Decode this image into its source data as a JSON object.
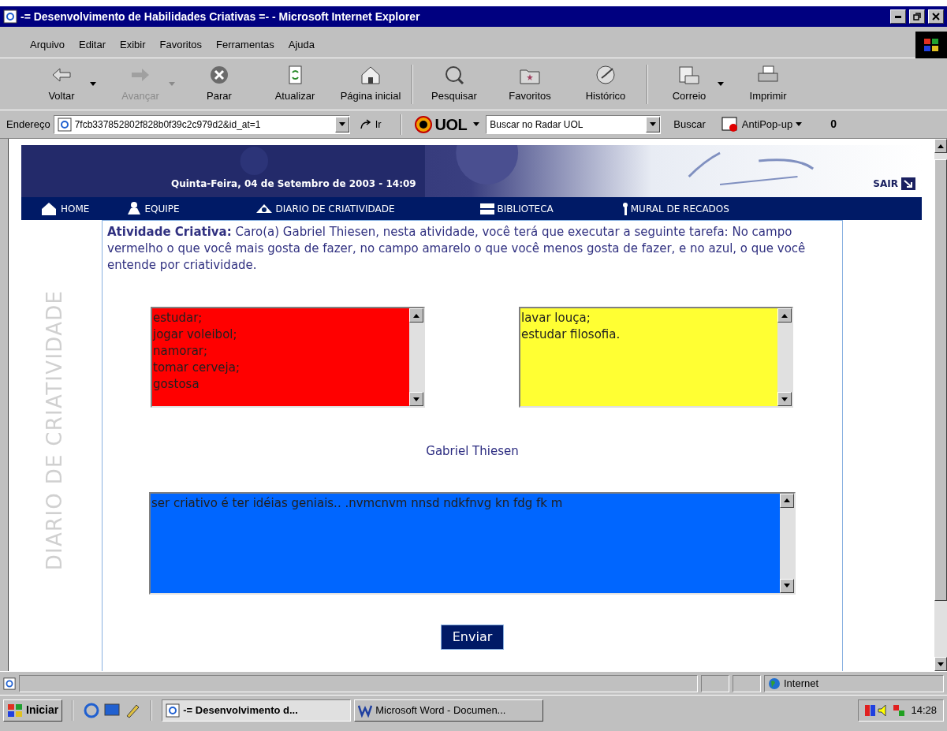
{
  "window": {
    "title": "-= Desenvolvimento de Habilidades Criativas =- - Microsoft Internet Explorer"
  },
  "menu": [
    "Arquivo",
    "Editar",
    "Exibir",
    "Favoritos",
    "Ferramentas",
    "Ajuda"
  ],
  "toolbar": [
    {
      "label": "Voltar",
      "disabled": false,
      "dropdown": true
    },
    {
      "label": "Avançar",
      "disabled": true,
      "dropdown": true
    },
    {
      "label": "Parar",
      "disabled": false,
      "dropdown": false
    },
    {
      "label": "Atualizar",
      "disabled": false,
      "dropdown": false
    },
    {
      "label": "Página inicial",
      "disabled": false,
      "dropdown": false
    },
    {
      "label": "Pesquisar",
      "disabled": false,
      "dropdown": false
    },
    {
      "label": "Favoritos",
      "disabled": false,
      "dropdown": false
    },
    {
      "label": "Histórico",
      "disabled": false,
      "dropdown": false
    },
    {
      "label": "Correio",
      "disabled": false,
      "dropdown": true
    },
    {
      "label": "Imprimir",
      "disabled": false,
      "dropdown": false
    }
  ],
  "address_bar": {
    "label": "Endereço",
    "value": "7fcb337852802f828b0f39c2c979d2&id_at=1",
    "go": "Ir",
    "brand": "UOL",
    "search_value": "Buscar no Radar UOL",
    "search_button": "Buscar",
    "antipopup": "AntiPop-up",
    "count": "0"
  },
  "page": {
    "side_label": "DIARIO DE CRIATIVIDADE",
    "date": "Quinta-Feira, 04 de Setembro de 2003 - 14:09",
    "logout": "SAIR",
    "nav": [
      "HOME",
      "EQUIPE",
      "DIARIO DE CRIATIVIDADE",
      "BIBLIOTECA",
      "MURAL DE RECADOS"
    ],
    "intro": "**Atividade Criativa:** Caro(a) Gabriel Thiesen, nesta atividade, você terá que executar a seguinte tarefa: No campo vermelho o que você mais gosta de fazer, no campo amarelo o que você menos gosta de fazer, e no azul, o que você entende por criatividade.",
    "fields": [
      {
        "color": "#ff0000",
        "lines": [
          "estudar;",
          "jogar voleibol;",
          "namorar;",
          "tomar cerveja;",
          "gostosa"
        ]
      },
      {
        "color": "#ffff33",
        "lines": [
          "lavar louça;",
          "estudar filosofia."
        ]
      },
      {
        "color": "#0066ff",
        "lines": [
          "ser criativo é ter idéias geniais.. .nvmcnvm nnsd ndkfnvg kn fdg fk m"
        ]
      }
    ],
    "name": "Gabriel Thiesen",
    "submit": "Enviar"
  },
  "status_bar": {
    "zone": "Internet"
  },
  "taskbar": {
    "start": "Iniciar",
    "tasks": [
      {
        "label": "-= Desenvolvimento d...",
        "selected": true
      },
      {
        "label": "Microsoft Word - Documen...",
        "selected": false
      }
    ],
    "time": "14:28"
  }
}
